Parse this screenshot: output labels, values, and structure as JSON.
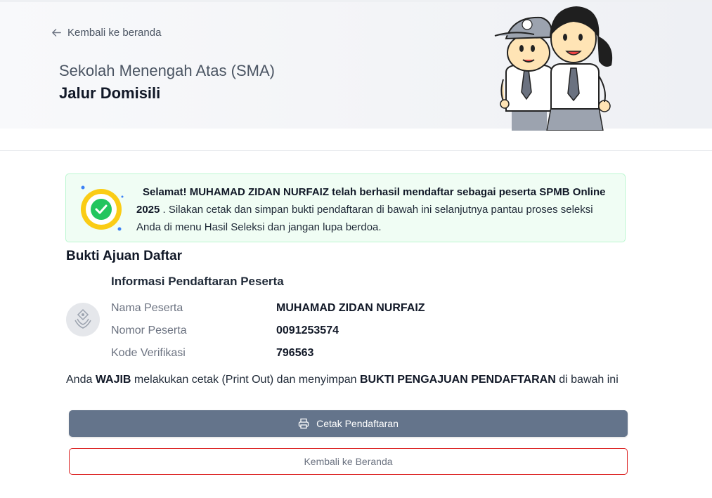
{
  "header": {
    "back_label": "Kembali ke beranda",
    "school_level": "Sekolah Menengah Atas (SMA)",
    "path_name": "Jalur Domisili"
  },
  "alert": {
    "greeting_bold": "Selamat! MUHAMAD ZIDAN NURFAIZ telah berhasil mendaftar sebagai peserta SPMB Online 2025",
    "message": " . Silakan cetak dan simpan bukti pendaftaran di bawah ini selanjutnya pantau proses seleksi Anda di menu Hasil Seleksi dan jangan lupa berdoa.",
    "icon": "check-circle-icon",
    "color": "#f0fdf4"
  },
  "proof": {
    "title": "Bukti Ajuan Daftar",
    "info_title": "Informasi Pendaftaran Peserta",
    "rows": [
      {
        "label": "Nama Peserta",
        "value": "MUHAMAD ZIDAN NURFAIZ"
      },
      {
        "label": "Nomor Peserta",
        "value": "0091253574"
      },
      {
        "label": "Kode Verifikasi",
        "value": "796563"
      }
    ]
  },
  "notice": {
    "part1": "Anda ",
    "bold1": "WAJIB",
    "part2": " melakukan cetak (Print Out) dan menyimpan ",
    "bold2": "BUKTI PENGAJUAN PENDAFTARAN",
    "part3": " di bawah ini"
  },
  "buttons": {
    "print_label": "Cetak Pendaftaran",
    "home_label": "Kembali ke Beranda"
  },
  "colors": {
    "primary_button": "#64748b",
    "home_border": "#dc2626",
    "success": "#22c55e"
  }
}
